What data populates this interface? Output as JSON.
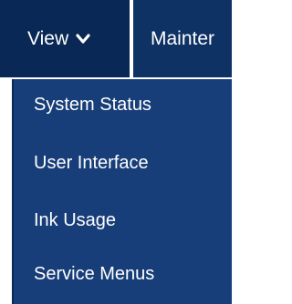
{
  "navbar": {
    "tabs": [
      {
        "label": "View",
        "icon": "chevron-down-icon"
      },
      {
        "label": "Mainter"
      }
    ]
  },
  "dropdown": {
    "items": [
      {
        "label": "System Status"
      },
      {
        "label": "User Interface"
      },
      {
        "label": "Ink Usage"
      },
      {
        "label": "Service Menus"
      }
    ]
  },
  "colors": {
    "navbar_bg": "#0f3264",
    "active_tab_bg": "#0a2855",
    "dropdown_bg": "#173e78",
    "text": "#ffffff"
  }
}
